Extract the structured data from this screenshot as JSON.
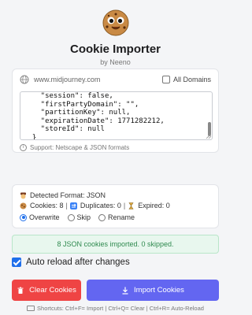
{
  "header": {
    "title": "Cookie Importer",
    "byline": "by Neeno"
  },
  "input": {
    "domain": "www.midjourney.com",
    "all_domains_label": "All Domains",
    "all_domains_checked": false,
    "code_lines": [
      "    \"session\": false,",
      "    \"firstPartyDomain\": \"\",",
      "    \"partitionKey\": null,",
      "    \"expirationDate\": 1771282212,",
      "    \"storeId\": null",
      "  }",
      "]"
    ],
    "support_text": "Support: Netscape & JSON formats"
  },
  "stats": {
    "detected_format": "Detected Format: JSON",
    "cookies": "Cookies: 8",
    "duplicates": "Duplicates: 0",
    "expired": "Expired: 0",
    "conflict_options": [
      "Overwrite",
      "Skip",
      "Rename"
    ],
    "selected_option": "Overwrite"
  },
  "result_message": "8 JSON cookies imported. 0 skipped.",
  "auto_reload": {
    "label": "Auto reload after changes",
    "checked": true
  },
  "buttons": {
    "clear": "Clear Cookies",
    "import": "Import Cookies"
  },
  "shortcuts": "Shortcuts: Ctrl+F= Import | Ctrl+Q= Clear | Ctrl+R= Auto-Reload",
  "colors": {
    "clear": "#ef4444",
    "import": "#6366f1",
    "accent": "#1f6feb",
    "success": "#2f8a4f"
  }
}
